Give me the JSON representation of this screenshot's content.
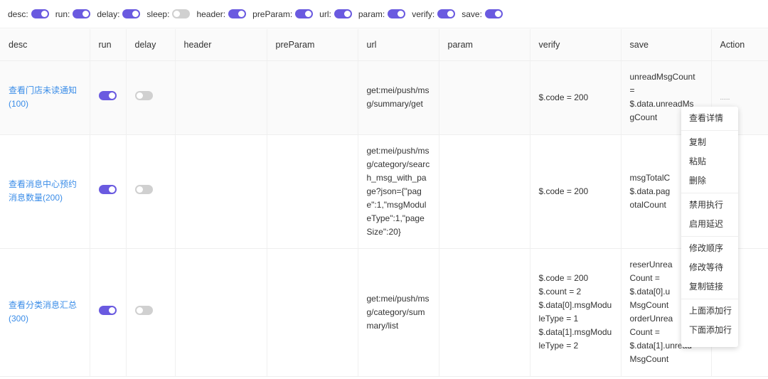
{
  "toggles": [
    {
      "label": "desc:",
      "on": true
    },
    {
      "label": "run:",
      "on": true
    },
    {
      "label": "delay:",
      "on": true
    },
    {
      "label": "sleep:",
      "on": false
    },
    {
      "label": "header:",
      "on": true
    },
    {
      "label": "preParam:",
      "on": true
    },
    {
      "label": "url:",
      "on": true
    },
    {
      "label": "param:",
      "on": true
    },
    {
      "label": "verify:",
      "on": true
    },
    {
      "label": "save:",
      "on": true
    }
  ],
  "columns": [
    "desc",
    "run",
    "delay",
    "header",
    "preParam",
    "url",
    "param",
    "verify",
    "save",
    "Action"
  ],
  "rows": [
    {
      "desc": "查看门店未读通知(100)",
      "run": true,
      "delay": false,
      "url": "get:mei/push/msg/summary/get",
      "verify": "$.code = 200",
      "save": "unreadMsgCount\n=\n$.data.unreadMs\ngCount",
      "action": "....."
    },
    {
      "desc": "查看消息中心预约消息数量(200)",
      "run": true,
      "delay": false,
      "url": "get:mei/push/msg/category/search_msg_with_page?json={\"page\":1,\"msgModuleType\":1,\"pageSize\":20}",
      "verify": "$.code = 200",
      "save": "msgTotalC\n$.data.pag\notalCount",
      "action": ""
    },
    {
      "desc": "查看分类消息汇总(300)",
      "run": true,
      "delay": false,
      "url": "get:mei/push/msg/category/summary/list",
      "verify": "$.code = 200\n$.count = 2\n$.data[0].msgModuleType = 1\n$.data[1].msgModuleType = 2",
      "save": "reserUnrea\nCount =\n$.data[0].u\nMsgCount\norderUnrea\nCount =\n$.data[1].unread\nMsgCount",
      "action": ""
    }
  ],
  "context_menu": {
    "groups": [
      [
        "查看详情"
      ],
      [
        "复制",
        "粘贴",
        "删除"
      ],
      [
        "禁用执行",
        "启用延迟"
      ],
      [
        "修改顺序",
        "修改等待",
        "复制链接"
      ],
      [
        "上面添加行",
        "下面添加行"
      ]
    ]
  },
  "colors": {
    "accent": "#6a5ae0",
    "link": "#3b8de8",
    "switch_off": "#d0d0d0"
  }
}
